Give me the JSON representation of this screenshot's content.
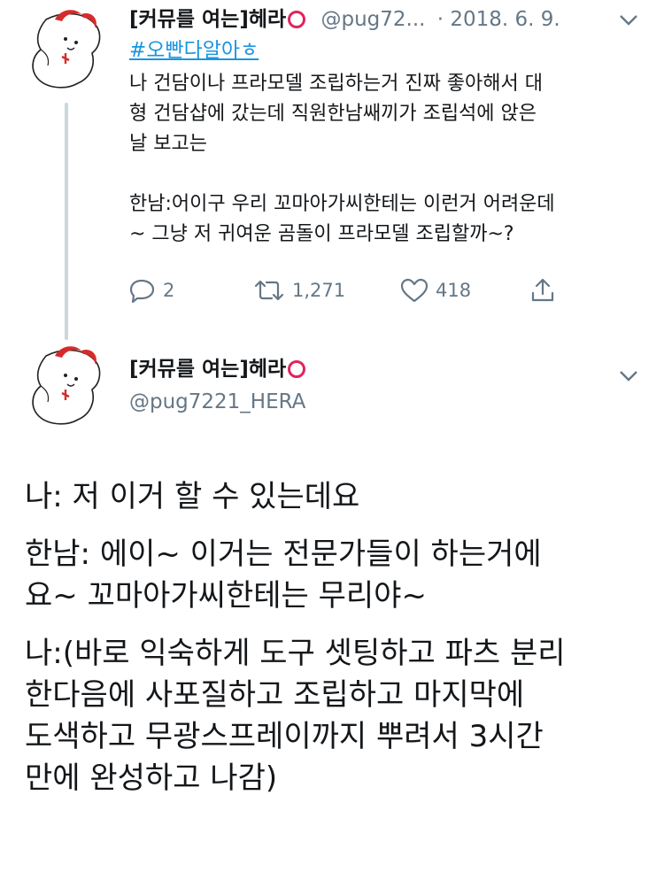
{
  "tweet1": {
    "display_name": "[커뮤를 여는]헤라",
    "handle": "@pug72...",
    "date": "· 2018. 6. 9.",
    "hashtag": "#오빤다알아ㅎ",
    "body": "나 건담이나 프라모델 조립하는거 진짜 좋아해서 대\n형 건담샵에 갔는데 직원한남쌔끼가 조립석에 앉은\n날 보고는\n\n한남:어이구 우리 꼬마아가씨한테는 이런거 어려운데\n~ 그냥 저 귀여운 곰돌이 프라모델 조립할까~?",
    "reply_count": "2",
    "retweet_count": "1,271",
    "like_count": "418"
  },
  "tweet2": {
    "display_name": "[커뮤를 여는]헤라",
    "handle": "@pug7221_HERA",
    "paragraphs": [
      "나: 저 이거 할 수 있는데요",
      "한남: 에이~ 이거는 전문가들이 하는거에\n요~ 꼬마아가씨한테는 무리야~",
      "나:(바로 익숙하게 도구 셋팅하고 파츠 분리\n한다음에 사포질하고 조립하고 마지막에\n도색하고 무광스프레이까지 뿌려서 3시간\n만에 완성하고 나감)"
    ]
  },
  "colors": {
    "link": "#1b95e0",
    "muted": "#657786",
    "ring": "#e0245e",
    "avatar_accent": "#d62b2b"
  },
  "icons": [
    "reply-icon",
    "retweet-icon",
    "like-icon",
    "share-icon",
    "chevron-down-icon"
  ]
}
